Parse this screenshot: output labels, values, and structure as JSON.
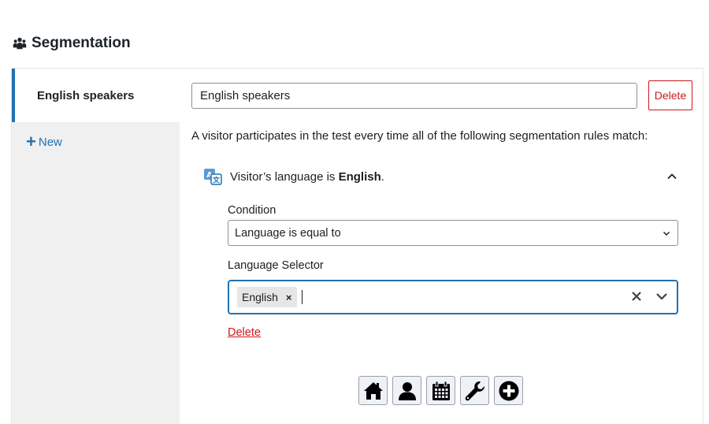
{
  "header": {
    "title": "Segmentation",
    "icon": "group-icon"
  },
  "sidebar": {
    "segments": [
      {
        "label": "English speakers"
      }
    ],
    "new_label": "New"
  },
  "segment": {
    "name_value": "English speakers",
    "delete_label": "Delete",
    "description": "A visitor participates in the test every time all of the following segmentation rules match:"
  },
  "rule": {
    "summary_prefix": "Visitor’s language is ",
    "summary_value": "English",
    "summary_suffix": ".",
    "condition_label": "Condition",
    "condition_value": "Language is equal to",
    "selector_label": "Language Selector",
    "selected_tags": [
      "English"
    ],
    "delete_label": "Delete"
  },
  "toolbar": {
    "buttons": [
      "home-icon",
      "user-icon",
      "calendar-icon",
      "wrench-icon",
      "plus-circle-icon"
    ]
  },
  "colors": {
    "accent": "#2271b1",
    "danger": "#cc1818",
    "sidebar_bg": "#f0f0f1"
  }
}
